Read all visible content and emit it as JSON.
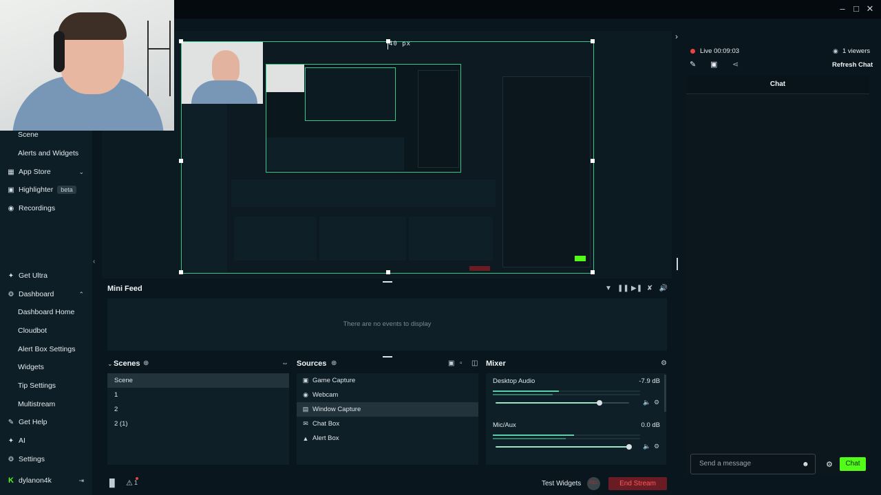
{
  "window": {
    "minimize_icon": "minimize-icon",
    "maximize_icon": "maximize-icon",
    "close_icon": "close-icon"
  },
  "sidebar": {
    "items": [
      {
        "label": "Scene",
        "icon": "",
        "sub": true
      },
      {
        "label": "Alerts and Widgets",
        "icon": "",
        "sub": true
      },
      {
        "label": "App Store",
        "icon": "app-store-icon",
        "chevron": "down"
      },
      {
        "label": "Highlighter",
        "icon": "highlighter-icon",
        "badge": "beta"
      },
      {
        "label": "Recordings",
        "icon": "recordings-icon"
      },
      {
        "label": "Get Ultra",
        "icon": "ultra-icon"
      },
      {
        "label": "Dashboard",
        "icon": "dashboard-icon",
        "chevron": "up"
      },
      {
        "label": "Dashboard Home",
        "sub": true
      },
      {
        "label": "Cloudbot",
        "sub": true
      },
      {
        "label": "Alert Box Settings",
        "sub": true
      },
      {
        "label": "Widgets",
        "sub": true
      },
      {
        "label": "Tip Settings",
        "sub": true
      },
      {
        "label": "Multistream",
        "sub": true
      },
      {
        "label": "Get Help",
        "icon": "help-icon"
      },
      {
        "label": "AI",
        "icon": "ai-icon"
      },
      {
        "label": "Settings",
        "icon": "settings-icon"
      }
    ],
    "user": "dylanon4k"
  },
  "preview": {
    "distance_label": "40 px"
  },
  "mini_feed": {
    "title": "Mini Feed",
    "empty_text": "There are no events to display"
  },
  "scenes": {
    "title": "Scenes",
    "items": [
      "Scene",
      "1",
      "2",
      "2 (1)"
    ],
    "selected": 0
  },
  "sources": {
    "title": "Sources",
    "items": [
      {
        "label": "Game Capture",
        "icon": "gamepad-icon"
      },
      {
        "label": "Webcam",
        "icon": "webcam-icon"
      },
      {
        "label": "Window Capture",
        "icon": "window-icon"
      },
      {
        "label": "Chat Box",
        "icon": "chat-icon"
      },
      {
        "label": "Alert Box",
        "icon": "alert-icon"
      }
    ],
    "selected": 2
  },
  "mixer": {
    "title": "Mixer",
    "channels": [
      {
        "name": "Desktop Audio",
        "db": "-7.9 dB",
        "meter": 0.45,
        "volume": 0.78
      },
      {
        "name": "Mic/Aux",
        "db": "0.0 dB",
        "meter": 0.55,
        "volume": 1.0
      }
    ]
  },
  "bottom": {
    "test_widgets": "Test Widgets",
    "rec": "REC",
    "end_stream": "End Stream",
    "alert_count": "1"
  },
  "chat": {
    "live_label": "Live 00:09:03",
    "viewers": "1 viewers",
    "refresh": "Refresh Chat",
    "header": "Chat",
    "placeholder": "Send a message",
    "send": "Chat"
  },
  "colors": {
    "accent_green": "#53fc18",
    "end_stream_red": "#ff5b5b",
    "selection_border": "#34c98a"
  }
}
